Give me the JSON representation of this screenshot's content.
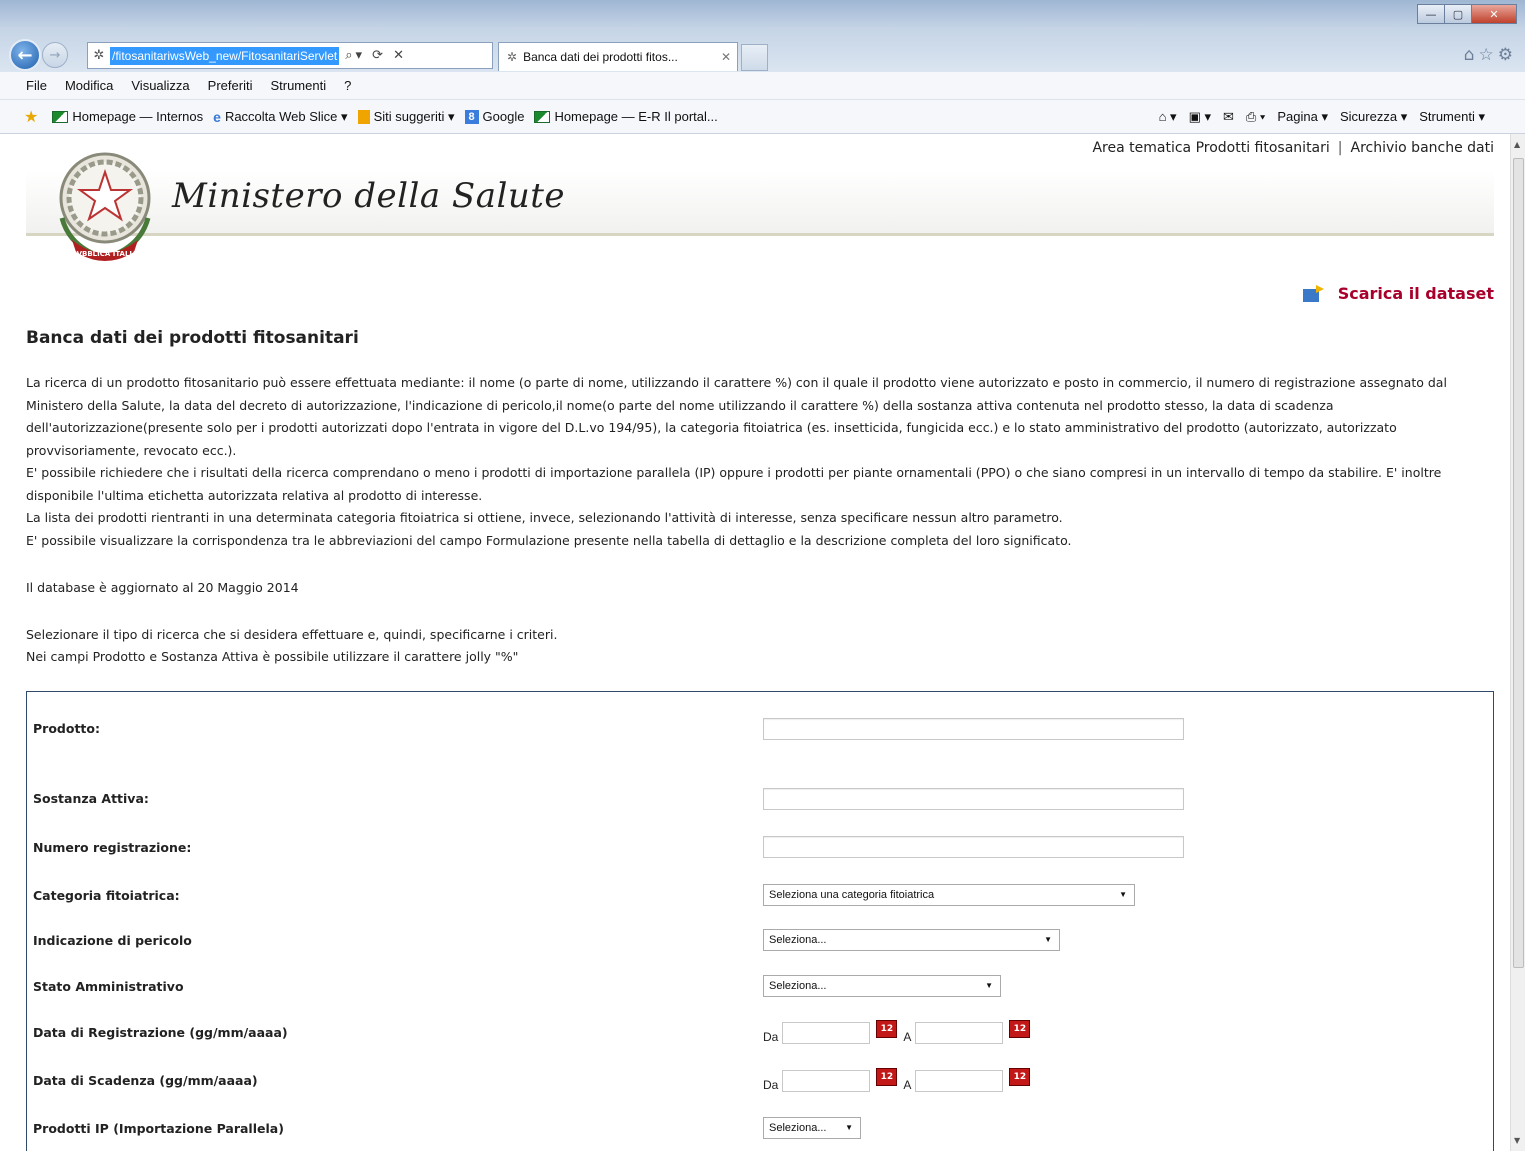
{
  "browser": {
    "url": "/fitosanitariwsWeb_new/FitosanitariServlet",
    "tab_title": "Banca dati dei prodotti fitos...",
    "menu": [
      "File",
      "Modifica",
      "Visualizza",
      "Preferiti",
      "Strumenti",
      "?"
    ],
    "favorites": [
      {
        "label": "Homepage — Internos",
        "icon": "flag-icon"
      },
      {
        "label": "Raccolta Web Slice ▾",
        "icon": "ie-icon"
      },
      {
        "label": "Siti suggeriti ▾",
        "icon": "bing-icon"
      },
      {
        "label": "Google",
        "icon": "google-icon"
      },
      {
        "label": "Homepage — E-R Il portal...",
        "icon": "flag-icon"
      }
    ],
    "commands": [
      "Pagina ▾",
      "Sicurezza ▾",
      "Strumenti ▾"
    ]
  },
  "page": {
    "top_links": [
      "Area tematica Prodotti fitosanitari",
      "Archivio banche dati"
    ],
    "ministry_name": "Ministero della Salute",
    "emblem_text": "REPVBBLICA ITALIANA",
    "dataset_link": "Scarica il dataset",
    "title": "Banca dati dei prodotti fitosanitari",
    "intro_paragraphs": [
      "La ricerca di un prodotto fitosanitario può essere effettuata mediante: il nome (o parte di nome, utilizzando il carattere %) con il quale il prodotto viene autorizzato e posto in commercio, il numero di registrazione assegnato dal Ministero della Salute, la data del decreto di autorizzazione, l'indicazione di pericolo,il nome(o parte del nome utilizzando il carattere %) della sostanza attiva contenuta nel prodotto stesso, la data di scadenza dell'autorizzazione(presente solo per i prodotti autorizzati dopo l'entrata in vigore del D.L.vo 194/95), la categoria fitoiatrica (es. insetticida, fungicida ecc.) e lo stato amministrativo del prodotto (autorizzato, autorizzato provvisoriamente, revocato ecc.).",
      "E' possibile richiedere che i risultati della ricerca comprendano o meno i prodotti di importazione parallela (IP) oppure i prodotti per piante ornamentali (PPO) o che siano compresi in un intervallo di tempo da stabilire. E' inoltre disponibile l'ultima etichetta autorizzata relativa al prodotto di interesse.",
      "La lista dei prodotti rientranti in una determinata categoria fitoiatrica si ottiene, invece, selezionando l'attività di interesse, senza specificare nessun altro parametro.",
      "E' possibile visualizzare la corrispondenza tra le abbreviazioni del campo Formulazione presente nella tabella di dettaglio e la descrizione completa del loro significato."
    ],
    "update_note": "Il database è aggiornato al 20 Maggio 2014",
    "instructions": [
      "Selezionare il tipo di ricerca che si desidera effettuare e, quindi, specificarne i criteri.",
      "Nei campi Prodotto e Sostanza Attiva è possibile utilizzare il carattere jolly \"%\""
    ]
  },
  "form": {
    "prodotto_label": "Prodotto:",
    "sostanza_label": "Sostanza Attiva:",
    "numero_label": "Numero registrazione:",
    "categoria_label": "Categoria fitoiatrica:",
    "categoria_value": "Seleziona una categoria fitoiatrica",
    "pericolo_label": "Indicazione di pericolo",
    "pericolo_value": "Seleziona...",
    "stato_label": "Stato Amministrativo",
    "stato_value": "Seleziona...",
    "data_reg_label": "Data di Registrazione (gg/mm/aaaa)",
    "data_scad_label": "Data di Scadenza (gg/mm/aaaa)",
    "from_label": "Da",
    "to_label": "A",
    "ip_label": "Prodotti IP (Importazione Parallela)",
    "ip_value": "Seleziona..."
  }
}
